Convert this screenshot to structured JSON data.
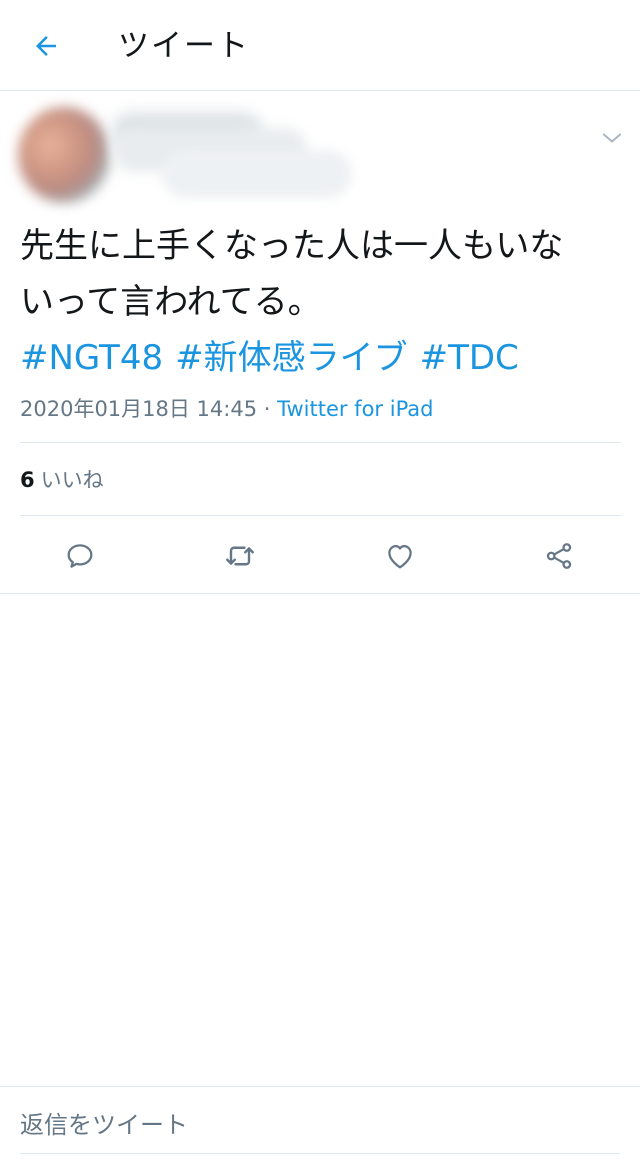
{
  "header": {
    "title": "ツイート"
  },
  "tweet": {
    "text_line1": "先生に上手くなった人は一人もいな",
    "text_line2": "いって言われてる。",
    "hashtags": [
      "#NGT48",
      "#新体感ライブ",
      "#TDC"
    ],
    "timestamp": "2020年01月18日 14:45",
    "separator": " · ",
    "source": "Twitter for iPad",
    "likes_count": "6",
    "likes_label": "いいね"
  },
  "actions": {
    "icons": [
      "reply-icon",
      "retweet-icon",
      "like-icon",
      "share-icon"
    ]
  },
  "reply_bar": {
    "placeholder": "返信をツイート"
  },
  "colors": {
    "accent": "#1b95e0",
    "text": "#14171a",
    "secondary": "#657786",
    "border": "#e1e8ed"
  }
}
